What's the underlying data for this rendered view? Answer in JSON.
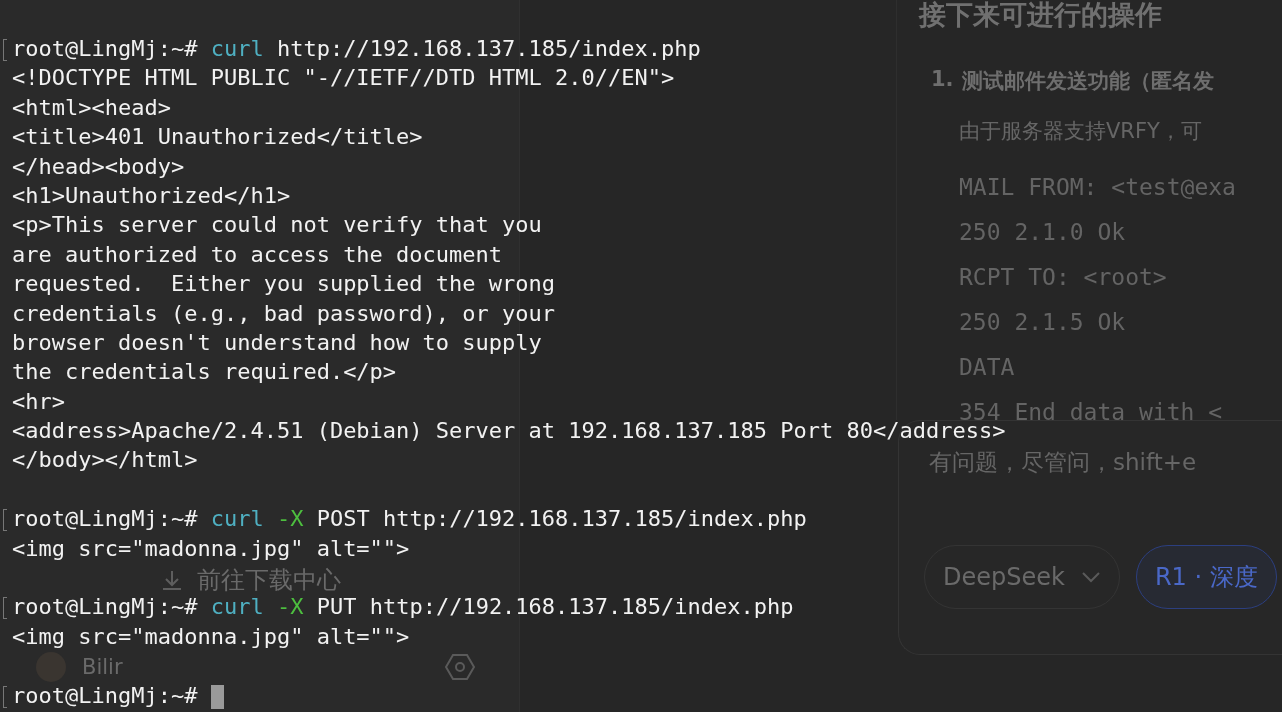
{
  "terminal": {
    "sessions": [
      {
        "prompt": "root@LingMj:~#",
        "command": [
          {
            "kind": "command",
            "text": "curl"
          },
          {
            "kind": "argument",
            "text": "http://192.168.137.185/index.php"
          }
        ],
        "output": [
          "<!DOCTYPE HTML PUBLIC \"-//IETF//DTD HTML 2.0//EN\">",
          "<html><head>",
          "<title>401 Unauthorized</title>",
          "</head><body>",
          "<h1>Unauthorized</h1>",
          "<p>This server could not verify that you",
          "are authorized to access the document",
          "requested.  Either you supplied the wrong",
          "credentials (e.g., bad password), or your",
          "browser doesn't understand how to supply",
          "the credentials required.</p>",
          "<hr>",
          "<address>Apache/2.4.51 (Debian) Server at 192.168.137.185 Port 80</address>",
          "</body></html>"
        ]
      },
      {
        "prompt": "root@LingMj:~#",
        "command": [
          {
            "kind": "command",
            "text": "curl"
          },
          {
            "kind": "flag",
            "text": "-X"
          },
          {
            "kind": "argument",
            "text": "POST"
          },
          {
            "kind": "argument",
            "text": "http://192.168.137.185/index.php"
          }
        ],
        "output": [
          "<img src=\"madonna.jpg\" alt=\"\">"
        ]
      },
      {
        "prompt": "root@LingMj:~#",
        "command": [
          {
            "kind": "command",
            "text": "curl"
          },
          {
            "kind": "flag",
            "text": "-X"
          },
          {
            "kind": "argument",
            "text": "PUT"
          },
          {
            "kind": "argument",
            "text": "http://192.168.137.185/index.php"
          }
        ],
        "output": [
          "<img src=\"madonna.jpg\" alt=\"\">"
        ]
      },
      {
        "prompt": "root@LingMj:~#",
        "cursor": true
      }
    ]
  },
  "sidebar": {
    "download_button": {
      "label": "前往下载中心"
    },
    "user": {
      "name": "Bilir"
    }
  },
  "chat": {
    "heading": "接下来可进行的操作",
    "steps": [
      {
        "number": "1.",
        "title": "测试邮件发送功能（匿名发"
      }
    ],
    "note": "由于服务器支持VRFY，可",
    "code_lines": [
      "MAIL FROM: <test@exa",
      "250 2.1.0 Ok",
      "RCPT TO: <root>",
      "250 2.1.5 Ok",
      "DATA",
      "354 End data with <"
    ],
    "input": {
      "placeholder": "有问题，尽管问，shift+e"
    },
    "model_button": {
      "label": "DeepSeek"
    },
    "mode_button": {
      "label": "R1 · 深度",
      "selected": true
    }
  }
}
